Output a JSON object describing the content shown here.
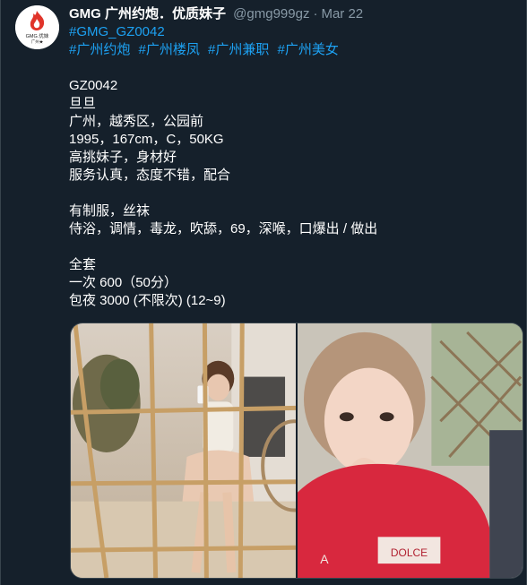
{
  "tweet": {
    "author": {
      "display_name": "GMG 广州约炮．优质妹子",
      "handle": "@gmg999gz",
      "date": "Mar 22",
      "avatar_text": "GMG.优妹",
      "avatar_subtext": "广州★"
    },
    "separator": "·",
    "tag_line": "#GMG_GZ0042",
    "hashtags": [
      "#广州约炮",
      "#广州楼凤",
      "#广州兼职",
      "#广州美女"
    ],
    "lines_block1": [
      "GZ0042",
      "旦旦",
      "广州，越秀区，公园前",
      "1995，167cm，C，50KG",
      "高挑妹子，身材好",
      "服务认真，态度不错，配合"
    ],
    "lines_block2": [
      "有制服，丝袜",
      "侍浴，调情，毒龙，吹舔，69，深喉，口爆出 / 做出"
    ],
    "lines_block3": [
      "全套",
      "一次 600（50分）",
      "包夜 3000 (不限次) (12~9)"
    ],
    "media": {
      "left_alt": "photo-1",
      "right_alt": "photo-2",
      "shirt_text": "DOLCE",
      "shirt_text2": "A"
    }
  },
  "colors": {
    "background": "#15202b",
    "link": "#1da1f2",
    "secondary_text": "#8899a6",
    "border": "#38444d"
  }
}
